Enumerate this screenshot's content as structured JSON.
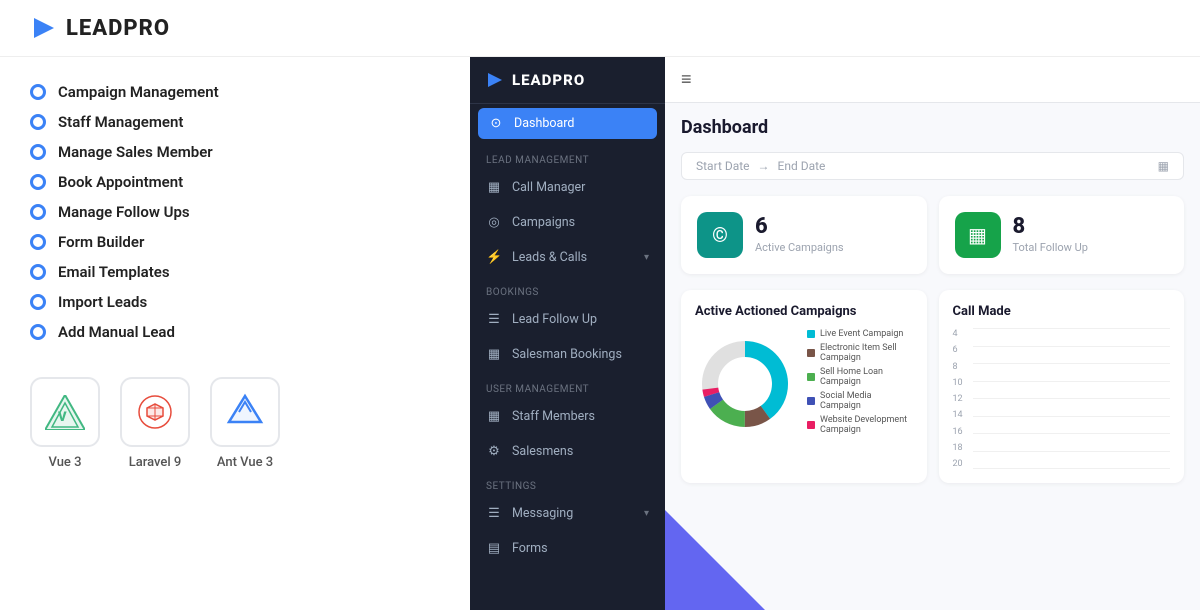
{
  "header": {
    "logo_text": "LEADPRO"
  },
  "features": {
    "items": [
      {
        "label": "Campaign Management"
      },
      {
        "label": "Staff Management"
      },
      {
        "label": "Manage Sales Member"
      },
      {
        "label": "Book Appointment"
      },
      {
        "label": "Manage Follow Ups"
      },
      {
        "label": "Form Builder"
      },
      {
        "label": "Email Templates"
      },
      {
        "label": "Import Leads"
      },
      {
        "label": "Add Manual Lead"
      }
    ]
  },
  "tech_badges": [
    {
      "label": "Vue 3",
      "icon": "vue"
    },
    {
      "label": "Laravel 9",
      "icon": "laravel"
    },
    {
      "label": "Ant Vue 3",
      "icon": "antvu"
    }
  ],
  "sidebar": {
    "logo_text": "LEADPRO",
    "nav": {
      "dashboard_label": "Dashboard",
      "sections": [
        {
          "label": "Lead Management",
          "items": [
            {
              "label": "Call Manager",
              "icon": "▦"
            },
            {
              "label": "Campaigns",
              "icon": "◎"
            },
            {
              "label": "Leads & Calls",
              "icon": "⚡",
              "has_arrow": true
            }
          ]
        },
        {
          "label": "Bookings",
          "items": [
            {
              "label": "Lead Follow Up",
              "icon": "☰"
            },
            {
              "label": "Salesman Bookings",
              "icon": "▦"
            }
          ]
        },
        {
          "label": "User Management",
          "items": [
            {
              "label": "Staff Members",
              "icon": "▦"
            },
            {
              "label": "Salesmens",
              "icon": "⚙"
            }
          ]
        },
        {
          "label": "Settings",
          "items": [
            {
              "label": "Messaging",
              "icon": "☰",
              "has_arrow": true
            },
            {
              "label": "Forms",
              "icon": "▤"
            }
          ]
        }
      ]
    }
  },
  "dashboard": {
    "title": "Dashboard",
    "hamburger": "≡",
    "date_start": "Start Date",
    "date_end": "End Date",
    "stats": [
      {
        "value": "6",
        "label": "Active Campaigns",
        "color": "teal",
        "icon": "©"
      },
      {
        "value": "8",
        "label": "Total Follow Up",
        "color": "green",
        "icon": "▦"
      }
    ],
    "charts": {
      "left_title": "Active Actioned Campaigns",
      "right_title": "Call Made",
      "donut_legend": [
        {
          "color": "#00bcd4",
          "label": "Live Event Campaign"
        },
        {
          "color": "#795548",
          "label": "Electronic Item Sell Campaign"
        },
        {
          "color": "#4caf50",
          "label": "Sell Home Loan Campaign"
        },
        {
          "color": "#3f51b5",
          "label": "Social Media Campaign"
        },
        {
          "color": "#e91e63",
          "label": "Website Development Campaign"
        }
      ],
      "bar_y_labels": [
        "20",
        "18",
        "16",
        "14",
        "12",
        "10",
        "8",
        "6",
        "4"
      ]
    }
  }
}
